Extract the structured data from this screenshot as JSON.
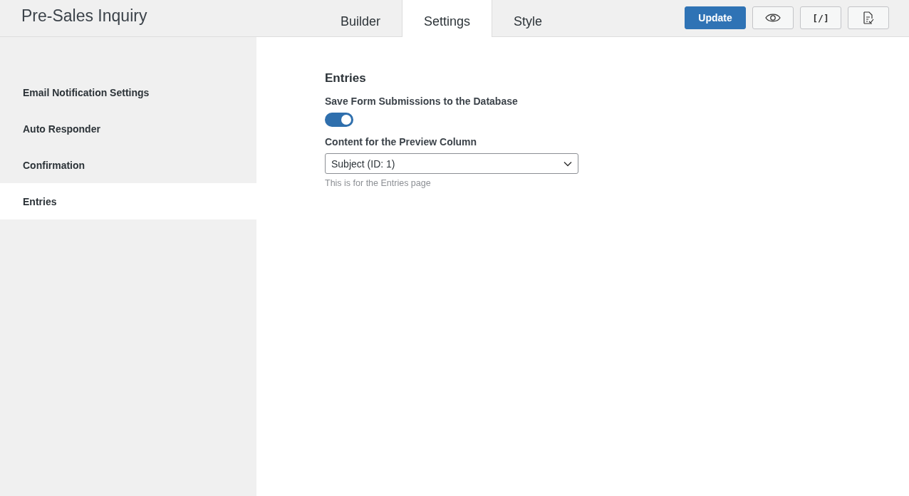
{
  "header": {
    "title": "Pre-Sales Inquiry"
  },
  "tabs": [
    {
      "label": "Builder",
      "selected": false
    },
    {
      "label": "Settings",
      "selected": true
    },
    {
      "label": "Style",
      "selected": false
    }
  ],
  "toolbar": {
    "update_label": "Update",
    "code_label": "[/]"
  },
  "sidebar": {
    "items": [
      {
        "label": "Email Notification Settings",
        "selected": false
      },
      {
        "label": "Auto Responder",
        "selected": false
      },
      {
        "label": "Confirmation",
        "selected": false
      },
      {
        "label": "Entries",
        "selected": true
      }
    ]
  },
  "panel": {
    "heading": "Entries",
    "save_label": "Save Form Submissions to the Database",
    "save_on": true,
    "preview_label": "Content for the Preview Column",
    "preview_value": "Subject (ID: 1)",
    "preview_help": "This is for the Entries page"
  }
}
